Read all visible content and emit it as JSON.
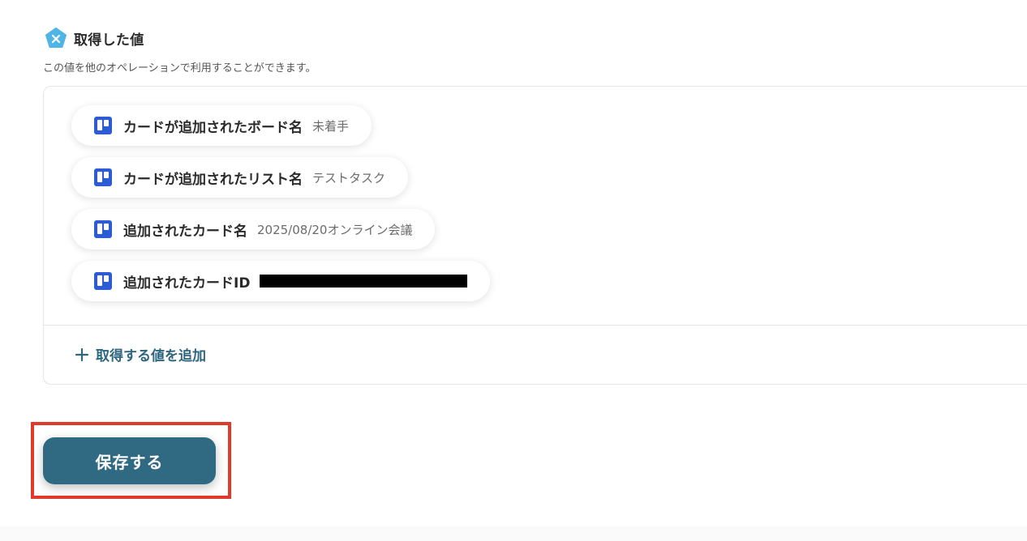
{
  "section": {
    "icon": "yoom-pentagon-icon",
    "title": "取得した値",
    "description": "この値を他のオペレーションで利用することができます。"
  },
  "values": [
    {
      "icon": "trello-icon",
      "label": "カードが追加されたボード名",
      "value": "未着手",
      "redacted": false
    },
    {
      "icon": "trello-icon",
      "label": "カードが追加されたリスト名",
      "value": "テストタスク",
      "redacted": false
    },
    {
      "icon": "trello-icon",
      "label": "追加されたカード名",
      "value": "2025/08/20オンライン会議",
      "redacted": false
    },
    {
      "icon": "trello-icon",
      "label": "追加されたカードID",
      "value": "",
      "redacted": true
    }
  ],
  "add_value": {
    "icon": "plus-icon",
    "label": "取得する値を追加"
  },
  "save_button": {
    "label": "保存する"
  },
  "colors": {
    "primary": "#2f6982",
    "accent_text": "#2e6680",
    "highlight": "#e03a2a",
    "trello": "#2d5bd6",
    "yoom_icon": "#4fb4e6"
  }
}
